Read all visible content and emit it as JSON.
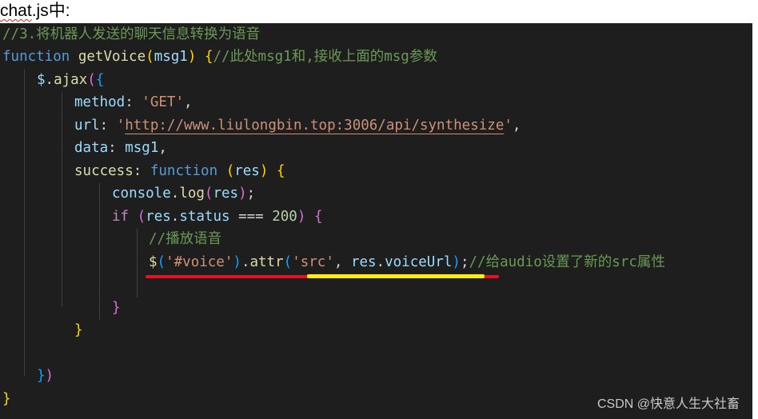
{
  "doc_title": {
    "prefix": "chat",
    "rest": ".js中:"
  },
  "code": {
    "l1": "//3.将机器人发送的聊天信息转换为语音",
    "l2": {
      "kw": "function",
      "name": "getVoice",
      "open": "(",
      "param": "msg1",
      "close": ")",
      "brace": "{",
      "comment": "//此处msg1和,接收上面的msg参数"
    },
    "l3": {
      "obj": "$",
      "dot": ".",
      "fn": "ajax",
      "open": "(",
      "brace": "{"
    },
    "l4": {
      "key": "method",
      "colon": ": ",
      "value": "'GET'",
      "comma": ","
    },
    "l5": {
      "key": "url",
      "colon": ": ",
      "quote_open": "'",
      "url": "http://www.liulongbin.top:3006/api/synthesize",
      "quote_close": "'",
      "comma": ","
    },
    "l6": {
      "key": "data",
      "colon": ": ",
      "value": "msg1",
      "comma": ","
    },
    "l7": {
      "key": "success",
      "colon": ": ",
      "kw": "function",
      "sp": " ",
      "open": "(",
      "param": "res",
      "close": ")",
      "sp2": " ",
      "brace": "{"
    },
    "l8": {
      "obj": "console",
      "dot": ".",
      "fn": "log",
      "open": "(",
      "arg": "res",
      "close": ")",
      "semi": ";"
    },
    "l9": {
      "kw": "if",
      "sp": " ",
      "open": "(",
      "obj": "res",
      "dot": ".",
      "prop": "status",
      "op": " === ",
      "num": "200",
      "close": ")",
      "sp2": " ",
      "brace": "{"
    },
    "l10": "//播放语音",
    "l11": {
      "obj": "$",
      "open": "(",
      "sel": "'#voice'",
      "close": ")",
      "dot": ".",
      "fn": "attr",
      "open2": "(",
      "attr": "'src'",
      "sep": ", ",
      "obj2": "res",
      "dot2": ".",
      "prop": "voiceUrl",
      "close2": ")",
      "semi": ";",
      "comment": "//给audio设置了新的src属性"
    },
    "l13": "}",
    "l14": "}",
    "l16": {
      "brace": "}",
      "paren": ")"
    },
    "l17": "}"
  },
  "watermark": "CSDN @快意人生大社畜",
  "colors": {
    "editor_bg": "#1e1e1e",
    "comment": "#6a9955",
    "keyword": "#569cd6",
    "function": "#dcdcaa",
    "string": "#ce9178",
    "number": "#b5cea8",
    "highlight_red": "#e81123",
    "highlight_yellow": "#fff000"
  }
}
